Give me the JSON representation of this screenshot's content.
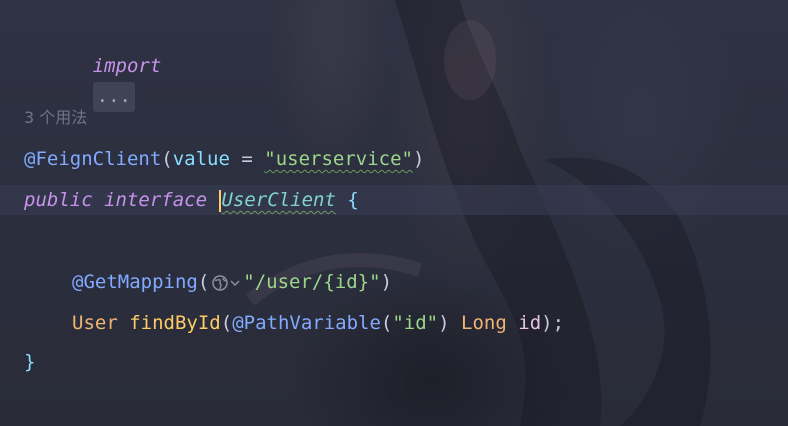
{
  "editor": {
    "line_import": {
      "keyword": "import",
      "folded": "..."
    },
    "usage_hint": "3 个用法",
    "line_annotation": {
      "annotation": "@FeignClient",
      "open": "(",
      "key": "value",
      "eq": " = ",
      "value": "\"userservice\"",
      "close": ")"
    },
    "line_interface": {
      "kw_public": "public",
      "kw_interface": "interface",
      "name": "UserClient",
      "brace": "{"
    },
    "line_get_mapping": {
      "annotation": "@GetMapping",
      "open": "(",
      "path": "\"/user/{id}\"",
      "close": ")"
    },
    "line_method": {
      "return_type": "User",
      "name": "findById",
      "open": "(",
      "param_annotation": "@PathVariable",
      "pa_open": "(",
      "pa_value": "\"id\"",
      "pa_close": ")",
      "param_type": "Long",
      "param_name": "id",
      "close": ");"
    },
    "line_close": {
      "brace": "}"
    },
    "icons": {
      "url_hint": "globe-icon",
      "dropdown": "chevron-down-icon"
    },
    "colors": {
      "background": "#2a2d3b",
      "keyword": "#c792ea",
      "annotation": "#82aaff",
      "string": "#9bd68a",
      "type": "#f0b573",
      "caret": "#ffcc66"
    }
  }
}
